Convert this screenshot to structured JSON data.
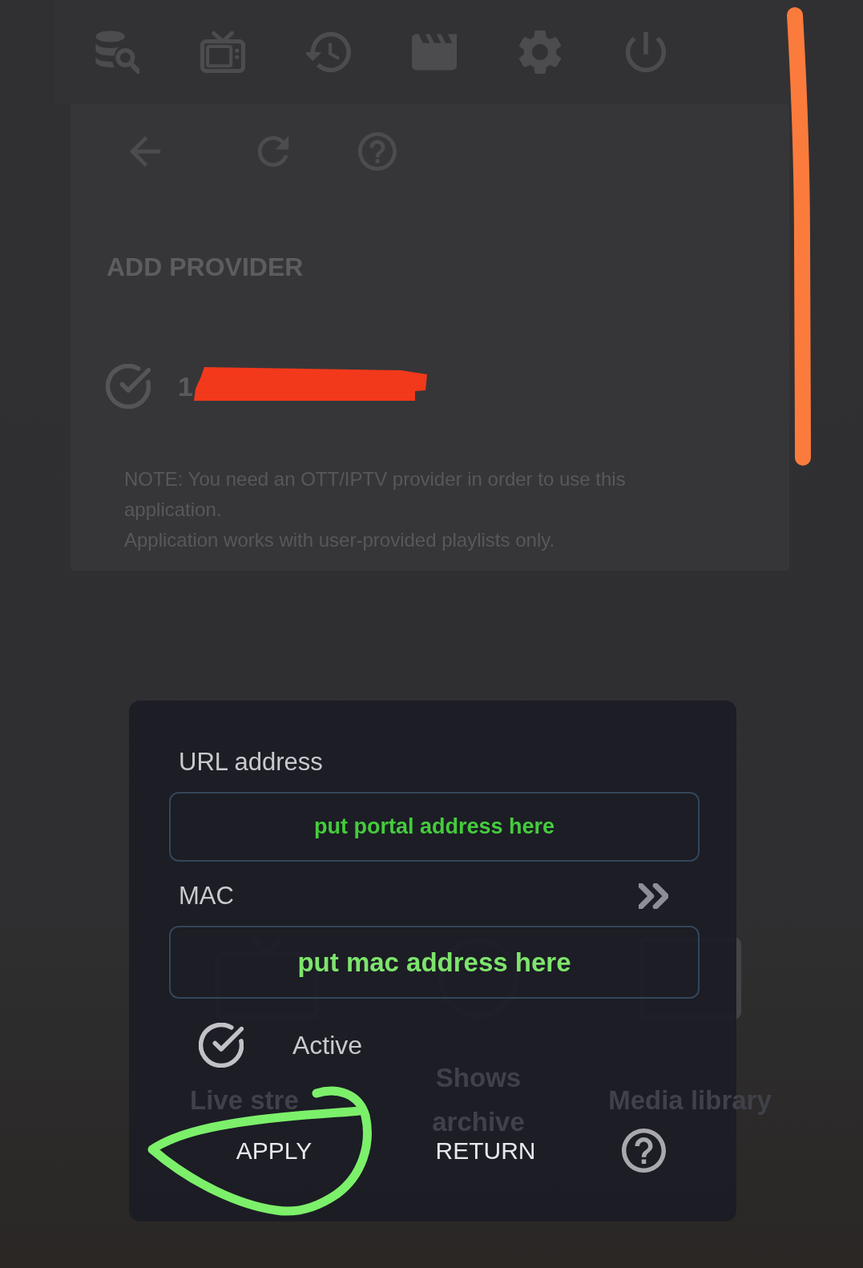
{
  "provider_panel": {
    "title": "ADD PROVIDER",
    "providers": [
      {
        "name": "1",
        "checked": true
      }
    ],
    "notes": [
      "NOTE: You need an OTT/IPTV provider in order to use this application.",
      "Application works with user-provided playlists only."
    ]
  },
  "home_tiles": [
    {
      "label": "Live stre"
    },
    {
      "label": "Shows archive"
    },
    {
      "label": "Media library"
    }
  ],
  "dialog": {
    "fields": [
      {
        "kind": "text",
        "label": "URL address",
        "value": "put portal address here"
      },
      {
        "kind": "picker",
        "label": "MAC",
        "value": "put mac address here"
      }
    ],
    "active": {
      "label": "Active",
      "checked": true
    },
    "buttons": [
      "APPLY",
      "RETURN"
    ]
  }
}
